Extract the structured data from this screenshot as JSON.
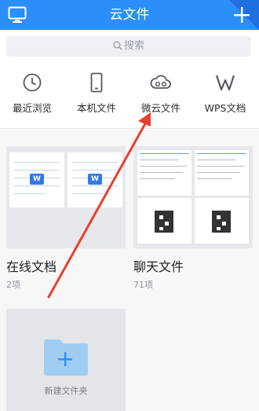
{
  "header": {
    "title": "云文件",
    "colors": {
      "bar": "#2c8ef8",
      "corner": "#1f6fe0"
    }
  },
  "search": {
    "placeholder": "搜索"
  },
  "quick": [
    {
      "label": "最近浏览",
      "icon": "clock-icon"
    },
    {
      "label": "本机文件",
      "icon": "phone-icon"
    },
    {
      "label": "微云文件",
      "icon": "cloud-icon"
    },
    {
      "label": "WPS文档",
      "icon": "wps-logo-icon"
    }
  ],
  "folders": [
    {
      "name": "在线文档",
      "count": "2项"
    },
    {
      "name": "聊天文件",
      "count": "71项"
    }
  ],
  "new_folder": {
    "label": "新建文件夹"
  },
  "annotation": {
    "color": "#e8402f"
  }
}
